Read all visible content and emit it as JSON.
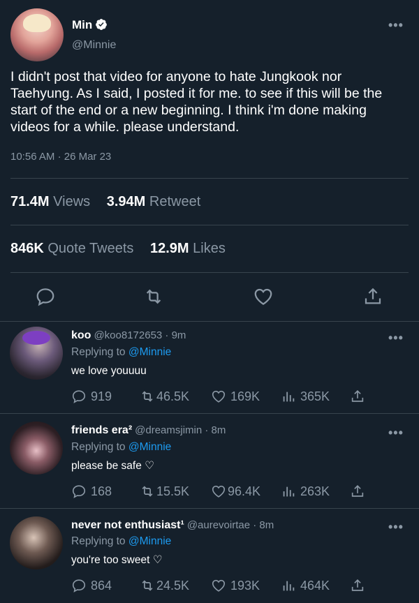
{
  "tweet": {
    "author": "Min",
    "handle": "@Minnie",
    "text": "I didn't post that video for anyone to hate Jungkook nor Taehyung. As I said, I posted it for me. to see if this will be the start of the end or a new beginning. I think i'm done making videos for a while. please understand.",
    "time": "10:56 AM",
    "separator": "·",
    "date": "26 Mar 23",
    "views_count": "71.4M",
    "views_label": "Views",
    "retweet_count": "3.94M",
    "retweet_label": "Retweet",
    "quote_count": "846K",
    "quote_label": "Quote Tweets",
    "likes_count": "12.9M",
    "likes_label": "Likes"
  },
  "replies": [
    {
      "name": "koo",
      "handle": "@koo8172653 · 9m",
      "replying_prefix": "Replying to",
      "replying_to": "@Minnie",
      "text": "we love youuuu",
      "replies": "919",
      "retweets": "46.5K",
      "likes": "169K",
      "views": "365K"
    },
    {
      "name": "friends era²",
      "handle": "@dreamsjimin · 8m",
      "replying_prefix": "Replying to",
      "replying_to": "@Minnie",
      "text": "please be safe ♡",
      "replies": "168",
      "retweets": "15.5K",
      "likes": "96.4K",
      "views": "263K"
    },
    {
      "name": "never not enthusiast¹",
      "handle": "@aurevoirtae · 8m",
      "replying_prefix": "Replying to",
      "replying_to": "@Minnie",
      "text": "you're too sweet ♡",
      "replies": "864",
      "retweets": "24.5K",
      "likes": "193K",
      "views": "464K"
    }
  ],
  "colors": {
    "background": "#15202b",
    "accent": "#1d9bf0",
    "muted": "#8b98a5",
    "divider": "#38444d"
  },
  "icons": [
    "verified-icon",
    "more-icon",
    "reply-icon",
    "retweet-icon",
    "like-icon",
    "share-icon",
    "views-icon"
  ]
}
